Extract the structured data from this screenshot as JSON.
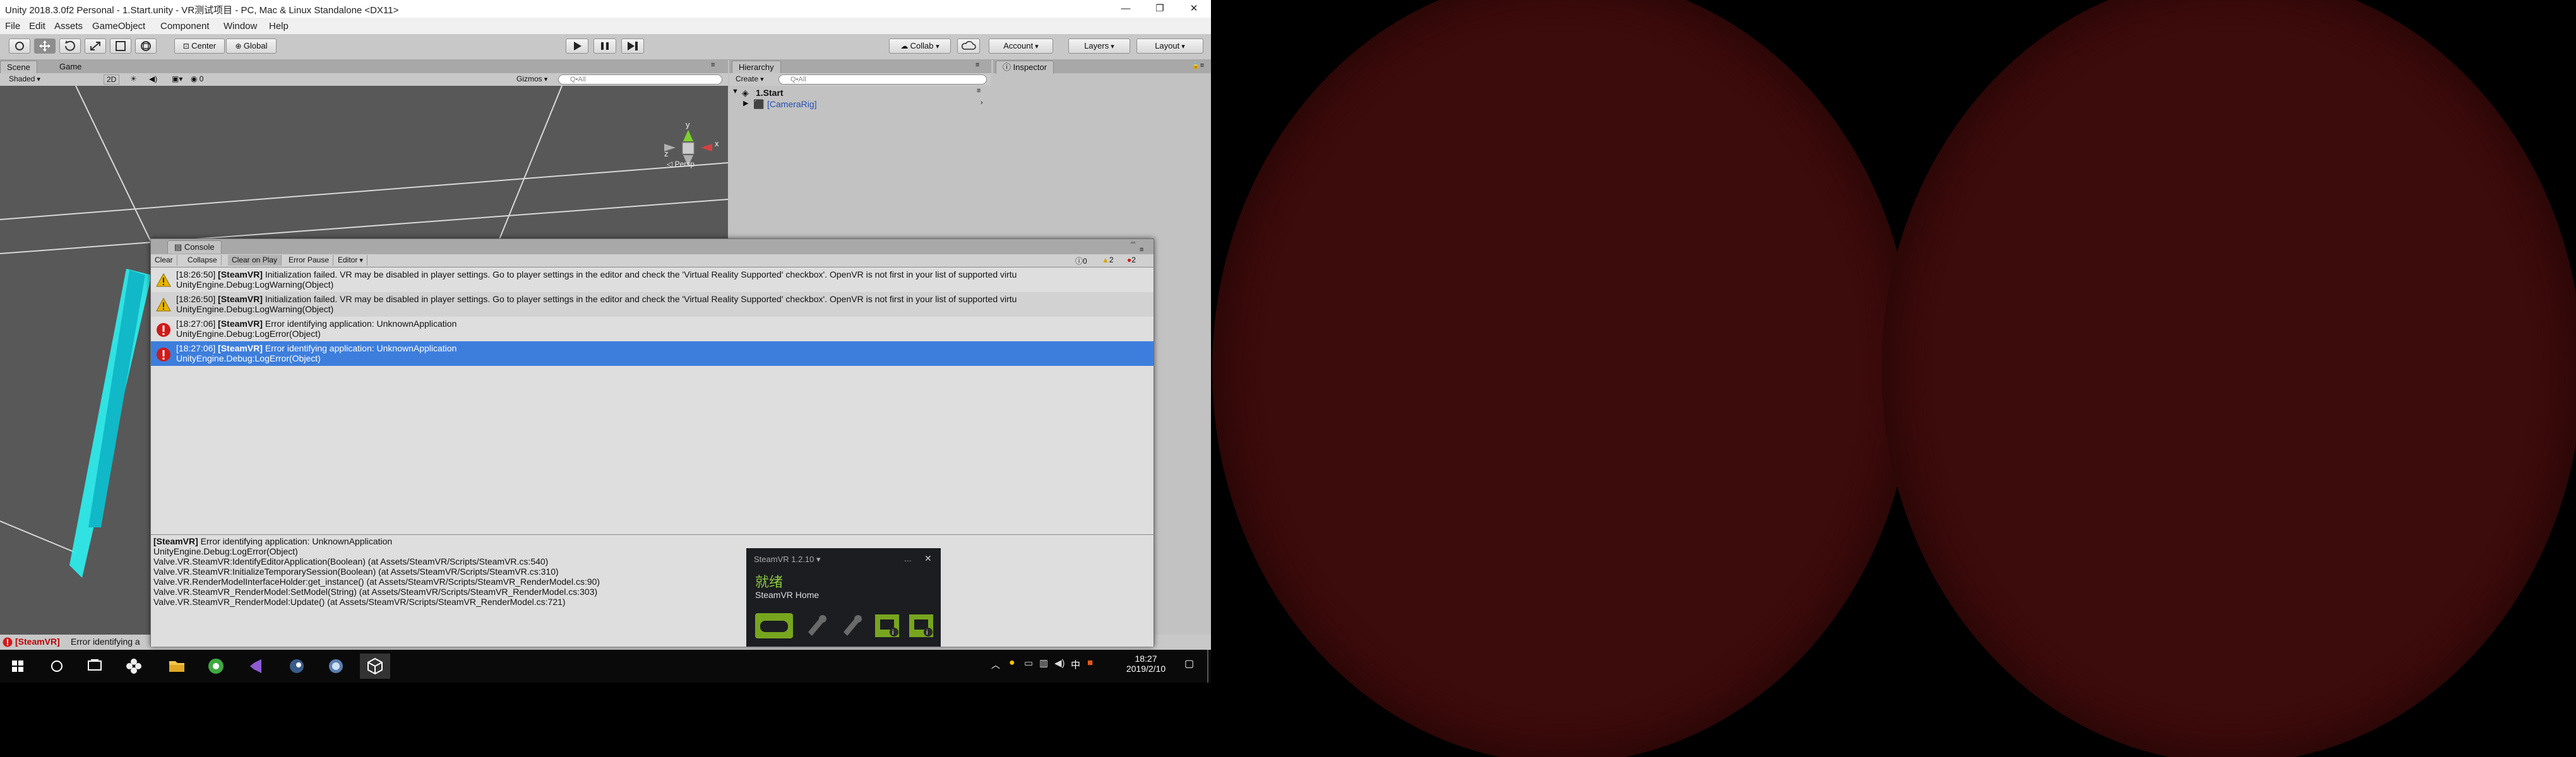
{
  "window": {
    "title": "Unity 2018.3.0f2 Personal - 1.Start.unity - VR测试项目 - PC, Mac & Linux Standalone <DX11>",
    "controls": [
      "—",
      "❐",
      "✕"
    ]
  },
  "menu": [
    "File",
    "Edit",
    "Assets",
    "GameObject",
    "Component",
    "Window",
    "Help"
  ],
  "toolbar": {
    "pivot": "Center",
    "space": "Global",
    "collab": "Collab",
    "account": "Account",
    "layers": "Layers",
    "layout": "Layout"
  },
  "scene": {
    "tabs": [
      "Scene",
      "Game"
    ],
    "shading": "Shaded",
    "mode2d": "2D",
    "gizmos": "Gizmos",
    "search_placeholder": "Q•All",
    "persp": "◁ Persp",
    "gizmo_labels": {
      "y": "y",
      "x": "x",
      "z": "z"
    }
  },
  "hierarchy": {
    "tab": "Hierarchy",
    "create": "Create",
    "search_placeholder": "Q•All",
    "scene_name": "1.Start",
    "items": [
      "[CameraRig]"
    ]
  },
  "inspector": {
    "tab": "Inspector"
  },
  "console": {
    "tab": "Console",
    "buttons": {
      "clear": "Clear",
      "collapse": "Collapse",
      "clear_on_play": "Clear on Play",
      "error_pause": "Error Pause",
      "editor": "Editor"
    },
    "counts": {
      "logs": "0",
      "warnings": "2",
      "errors": "2"
    },
    "rows": [
      {
        "type": "warning",
        "time": "[18:26:50]",
        "tag": "[SteamVR]",
        "msg": " Initialization failed.  VR may be disabled in player settings.  Go to player settings in the editor and check the 'Virtual Reality Supported' checkbox'.  OpenVR is not first in your list of supported virtu",
        "sub": "UnityEngine.Debug:LogWarning(Object)"
      },
      {
        "type": "warning",
        "time": "[18:26:50]",
        "tag": "[SteamVR]",
        "msg": " Initialization failed.  VR may be disabled in player settings.  Go to player settings in the editor and check the 'Virtual Reality Supported' checkbox'.  OpenVR is not first in your list of supported virtu",
        "sub": "UnityEngine.Debug:LogWarning(Object)"
      },
      {
        "type": "error",
        "time": "[18:27:06]",
        "tag": "[SteamVR]",
        "msg": " Error identifying application: UnknownApplication",
        "sub": "UnityEngine.Debug:LogError(Object)"
      },
      {
        "type": "error",
        "time": "[18:27:06]",
        "tag": "[SteamVR]",
        "msg": " Error identifying application: UnknownApplication",
        "sub": "UnityEngine.Debug:LogError(Object)"
      }
    ],
    "detail": {
      "tag": "[SteamVR]",
      "first": " Error identifying application: UnknownApplication",
      "lines": [
        "UnityEngine.Debug:LogError(Object)",
        "Valve.VR.SteamVR:IdentifyEditorApplication(Boolean) (at Assets/SteamVR/Scripts/SteamVR.cs:540)",
        "Valve.VR.SteamVR:InitializeTemporarySession(Boolean) (at Assets/SteamVR/Scripts/SteamVR.cs:310)",
        "Valve.VR.RenderModelInterfaceHolder:get_instance() (at Assets/SteamVR/Scripts/SteamVR_RenderModel.cs:90)",
        "Valve.VR.SteamVR_RenderModel:SetModel(String) (at Assets/SteamVR/Scripts/SteamVR_RenderModel.cs:303)",
        "Valve.VR.SteamVR_RenderModel:Update() (at Assets/SteamVR/Scripts/SteamVR_RenderModel.cs:721)"
      ]
    }
  },
  "statusbar": {
    "tag": "[SteamVR]",
    "text": " Error identifying a"
  },
  "steamvr": {
    "title": "SteamVR 1.2.10 ▾",
    "status": "就绪",
    "home": "SteamVR Home",
    "controls": [
      "...",
      "✕"
    ]
  },
  "taskbar": {
    "time": "18:27",
    "date": "2019/2/10",
    "ime": "中",
    "icons": [
      "windows-start",
      "search",
      "task-view",
      "app-flower",
      "file-explorer",
      "app-green",
      "visual-studio",
      "steam",
      "app-blue",
      "unity"
    ]
  },
  "colors": {
    "selection": "#3d7edc",
    "vr_red": "#3c0b0b",
    "accent_green": "#78a51e"
  }
}
